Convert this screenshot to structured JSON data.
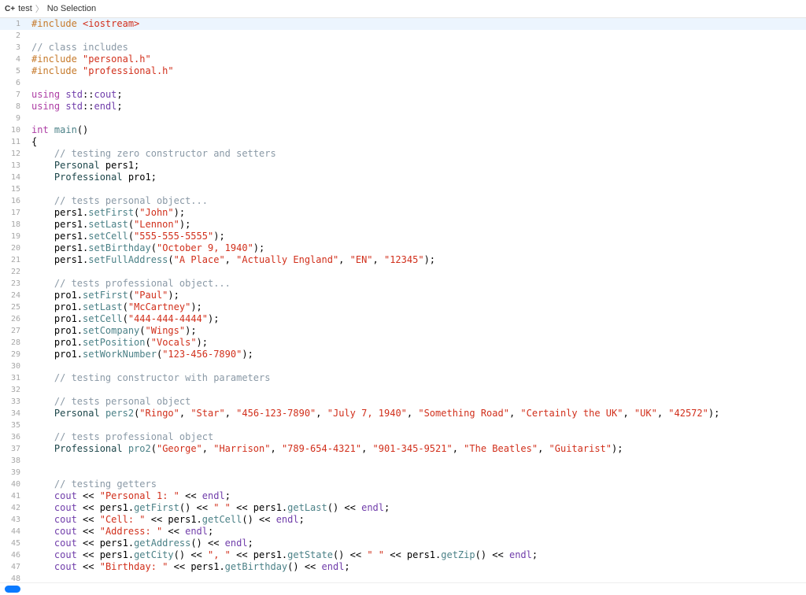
{
  "breadcrumb": {
    "lang_icon": "C+",
    "file": "test",
    "selection": "No Selection"
  },
  "highlight_line": 1,
  "lines": [
    {
      "n": 1,
      "tokens": [
        [
          "pp",
          "#include "
        ],
        [
          "inc",
          "<iostream>"
        ]
      ]
    },
    {
      "n": 2,
      "tokens": []
    },
    {
      "n": 3,
      "tokens": [
        [
          "cmt",
          "// class includes"
        ]
      ]
    },
    {
      "n": 4,
      "tokens": [
        [
          "pp",
          "#include "
        ],
        [
          "inc",
          "\"personal.h\""
        ]
      ]
    },
    {
      "n": 5,
      "tokens": [
        [
          "pp",
          "#include "
        ],
        [
          "inc",
          "\"professional.h\""
        ]
      ]
    },
    {
      "n": 6,
      "tokens": []
    },
    {
      "n": 7,
      "tokens": [
        [
          "kw",
          "using"
        ],
        [
          "txt",
          " "
        ],
        [
          "ns",
          "std"
        ],
        [
          "txt",
          "::"
        ],
        [
          "ns",
          "cout"
        ],
        [
          "txt",
          ";"
        ]
      ]
    },
    {
      "n": 8,
      "tokens": [
        [
          "kw",
          "using"
        ],
        [
          "txt",
          " "
        ],
        [
          "ns",
          "std"
        ],
        [
          "txt",
          "::"
        ],
        [
          "ns",
          "endl"
        ],
        [
          "txt",
          ";"
        ]
      ]
    },
    {
      "n": 9,
      "tokens": []
    },
    {
      "n": 10,
      "tokens": [
        [
          "kw",
          "int"
        ],
        [
          "txt",
          " "
        ],
        [
          "fn",
          "main"
        ],
        [
          "txt",
          "()"
        ]
      ]
    },
    {
      "n": 11,
      "tokens": [
        [
          "txt",
          "{"
        ]
      ]
    },
    {
      "n": 12,
      "tokens": [
        [
          "txt",
          "    "
        ],
        [
          "cmt",
          "// testing zero constructor and setters"
        ]
      ]
    },
    {
      "n": 13,
      "tokens": [
        [
          "txt",
          "    "
        ],
        [
          "type",
          "Personal"
        ],
        [
          "txt",
          " pers1;"
        ]
      ]
    },
    {
      "n": 14,
      "tokens": [
        [
          "txt",
          "    "
        ],
        [
          "type",
          "Professional"
        ],
        [
          "txt",
          " pro1;"
        ]
      ]
    },
    {
      "n": 15,
      "tokens": []
    },
    {
      "n": 16,
      "tokens": [
        [
          "txt",
          "    "
        ],
        [
          "cmt",
          "// tests personal object..."
        ]
      ]
    },
    {
      "n": 17,
      "tokens": [
        [
          "txt",
          "    pers1."
        ],
        [
          "fn",
          "setFirst"
        ],
        [
          "txt",
          "("
        ],
        [
          "inc",
          "\"John\""
        ],
        [
          "txt",
          ");"
        ]
      ]
    },
    {
      "n": 18,
      "tokens": [
        [
          "txt",
          "    pers1."
        ],
        [
          "fn",
          "setLast"
        ],
        [
          "txt",
          "("
        ],
        [
          "inc",
          "\"Lennon\""
        ],
        [
          "txt",
          ");"
        ]
      ]
    },
    {
      "n": 19,
      "tokens": [
        [
          "txt",
          "    pers1."
        ],
        [
          "fn",
          "setCell"
        ],
        [
          "txt",
          "("
        ],
        [
          "inc",
          "\"555-555-5555\""
        ],
        [
          "txt",
          ");"
        ]
      ]
    },
    {
      "n": 20,
      "tokens": [
        [
          "txt",
          "    pers1."
        ],
        [
          "fn",
          "setBirthday"
        ],
        [
          "txt",
          "("
        ],
        [
          "inc",
          "\"October 9, 1940\""
        ],
        [
          "txt",
          ");"
        ]
      ]
    },
    {
      "n": 21,
      "tokens": [
        [
          "txt",
          "    pers1."
        ],
        [
          "fn",
          "setFullAddress"
        ],
        [
          "txt",
          "("
        ],
        [
          "inc",
          "\"A Place\""
        ],
        [
          "txt",
          ", "
        ],
        [
          "inc",
          "\"Actually England\""
        ],
        [
          "txt",
          ", "
        ],
        [
          "inc",
          "\"EN\""
        ],
        [
          "txt",
          ", "
        ],
        [
          "inc",
          "\"12345\""
        ],
        [
          "txt",
          ");"
        ]
      ]
    },
    {
      "n": 22,
      "tokens": []
    },
    {
      "n": 23,
      "tokens": [
        [
          "txt",
          "    "
        ],
        [
          "cmt",
          "// tests professional object..."
        ]
      ]
    },
    {
      "n": 24,
      "tokens": [
        [
          "txt",
          "    pro1."
        ],
        [
          "fn",
          "setFirst"
        ],
        [
          "txt",
          "("
        ],
        [
          "inc",
          "\"Paul\""
        ],
        [
          "txt",
          ");"
        ]
      ]
    },
    {
      "n": 25,
      "tokens": [
        [
          "txt",
          "    pro1."
        ],
        [
          "fn",
          "setLast"
        ],
        [
          "txt",
          "("
        ],
        [
          "inc",
          "\"McCartney\""
        ],
        [
          "txt",
          ");"
        ]
      ]
    },
    {
      "n": 26,
      "tokens": [
        [
          "txt",
          "    pro1."
        ],
        [
          "fn",
          "setCell"
        ],
        [
          "txt",
          "("
        ],
        [
          "inc",
          "\"444-444-4444\""
        ],
        [
          "txt",
          ");"
        ]
      ]
    },
    {
      "n": 27,
      "tokens": [
        [
          "txt",
          "    pro1."
        ],
        [
          "fn",
          "setCompany"
        ],
        [
          "txt",
          "("
        ],
        [
          "inc",
          "\"Wings\""
        ],
        [
          "txt",
          ");"
        ]
      ]
    },
    {
      "n": 28,
      "tokens": [
        [
          "txt",
          "    pro1."
        ],
        [
          "fn",
          "setPosition"
        ],
        [
          "txt",
          "("
        ],
        [
          "inc",
          "\"Vocals\""
        ],
        [
          "txt",
          ");"
        ]
      ]
    },
    {
      "n": 29,
      "tokens": [
        [
          "txt",
          "    pro1."
        ],
        [
          "fn",
          "setWorkNumber"
        ],
        [
          "txt",
          "("
        ],
        [
          "inc",
          "\"123-456-7890\""
        ],
        [
          "txt",
          ");"
        ]
      ]
    },
    {
      "n": 30,
      "tokens": []
    },
    {
      "n": 31,
      "tokens": [
        [
          "txt",
          "    "
        ],
        [
          "cmt",
          "// testing constructor with parameters"
        ]
      ]
    },
    {
      "n": 32,
      "tokens": []
    },
    {
      "n": 33,
      "tokens": [
        [
          "txt",
          "    "
        ],
        [
          "cmt",
          "// tests personal object"
        ]
      ]
    },
    {
      "n": 34,
      "tokens": [
        [
          "txt",
          "    "
        ],
        [
          "type",
          "Personal"
        ],
        [
          "txt",
          " "
        ],
        [
          "fn",
          "pers2"
        ],
        [
          "txt",
          "("
        ],
        [
          "inc",
          "\"Ringo\""
        ],
        [
          "txt",
          ", "
        ],
        [
          "inc",
          "\"Star\""
        ],
        [
          "txt",
          ", "
        ],
        [
          "inc",
          "\"456-123-7890\""
        ],
        [
          "txt",
          ", "
        ],
        [
          "inc",
          "\"July 7, 1940\""
        ],
        [
          "txt",
          ", "
        ],
        [
          "inc",
          "\"Something Road\""
        ],
        [
          "txt",
          ", "
        ],
        [
          "inc",
          "\"Certainly the UK\""
        ],
        [
          "txt",
          ", "
        ],
        [
          "inc",
          "\"UK\""
        ],
        [
          "txt",
          ", "
        ],
        [
          "inc",
          "\"42572\""
        ],
        [
          "txt",
          ");"
        ]
      ]
    },
    {
      "n": 35,
      "tokens": []
    },
    {
      "n": 36,
      "tokens": [
        [
          "txt",
          "    "
        ],
        [
          "cmt",
          "// tests professional object"
        ]
      ]
    },
    {
      "n": 37,
      "tokens": [
        [
          "txt",
          "    "
        ],
        [
          "type",
          "Professional"
        ],
        [
          "txt",
          " "
        ],
        [
          "fn",
          "pro2"
        ],
        [
          "txt",
          "("
        ],
        [
          "inc",
          "\"George\""
        ],
        [
          "txt",
          ", "
        ],
        [
          "inc",
          "\"Harrison\""
        ],
        [
          "txt",
          ", "
        ],
        [
          "inc",
          "\"789-654-4321\""
        ],
        [
          "txt",
          ", "
        ],
        [
          "inc",
          "\"901-345-9521\""
        ],
        [
          "txt",
          ", "
        ],
        [
          "inc",
          "\"The Beatles\""
        ],
        [
          "txt",
          ", "
        ],
        [
          "inc",
          "\"Guitarist\""
        ],
        [
          "txt",
          ");"
        ]
      ]
    },
    {
      "n": 38,
      "tokens": []
    },
    {
      "n": 39,
      "tokens": []
    },
    {
      "n": 40,
      "tokens": [
        [
          "txt",
          "    "
        ],
        [
          "cmt",
          "// testing getters"
        ]
      ]
    },
    {
      "n": 41,
      "tokens": [
        [
          "txt",
          "    "
        ],
        [
          "ns",
          "cout"
        ],
        [
          "txt",
          " << "
        ],
        [
          "inc",
          "\"Personal 1: \""
        ],
        [
          "txt",
          " << "
        ],
        [
          "ns",
          "endl"
        ],
        [
          "txt",
          ";"
        ]
      ]
    },
    {
      "n": 42,
      "tokens": [
        [
          "txt",
          "    "
        ],
        [
          "ns",
          "cout"
        ],
        [
          "txt",
          " << pers1."
        ],
        [
          "fn",
          "getFirst"
        ],
        [
          "txt",
          "() << "
        ],
        [
          "inc",
          "\" \""
        ],
        [
          "txt",
          " << pers1."
        ],
        [
          "fn",
          "getLast"
        ],
        [
          "txt",
          "() << "
        ],
        [
          "ns",
          "endl"
        ],
        [
          "txt",
          ";"
        ]
      ]
    },
    {
      "n": 43,
      "tokens": [
        [
          "txt",
          "    "
        ],
        [
          "ns",
          "cout"
        ],
        [
          "txt",
          " << "
        ],
        [
          "inc",
          "\"Cell: \""
        ],
        [
          "txt",
          " << pers1."
        ],
        [
          "fn",
          "getCell"
        ],
        [
          "txt",
          "() << "
        ],
        [
          "ns",
          "endl"
        ],
        [
          "txt",
          ";"
        ]
      ]
    },
    {
      "n": 44,
      "tokens": [
        [
          "txt",
          "    "
        ],
        [
          "ns",
          "cout"
        ],
        [
          "txt",
          " << "
        ],
        [
          "inc",
          "\"Address: \""
        ],
        [
          "txt",
          " << "
        ],
        [
          "ns",
          "endl"
        ],
        [
          "txt",
          ";"
        ]
      ]
    },
    {
      "n": 45,
      "tokens": [
        [
          "txt",
          "    "
        ],
        [
          "ns",
          "cout"
        ],
        [
          "txt",
          " << pers1."
        ],
        [
          "fn",
          "getAddress"
        ],
        [
          "txt",
          "() << "
        ],
        [
          "ns",
          "endl"
        ],
        [
          "txt",
          ";"
        ]
      ]
    },
    {
      "n": 46,
      "tokens": [
        [
          "txt",
          "    "
        ],
        [
          "ns",
          "cout"
        ],
        [
          "txt",
          " << pers1."
        ],
        [
          "fn",
          "getCity"
        ],
        [
          "txt",
          "() << "
        ],
        [
          "inc",
          "\", \""
        ],
        [
          "txt",
          " << pers1."
        ],
        [
          "fn",
          "getState"
        ],
        [
          "txt",
          "() << "
        ],
        [
          "inc",
          "\" \""
        ],
        [
          "txt",
          " << pers1."
        ],
        [
          "fn",
          "getZip"
        ],
        [
          "txt",
          "() << "
        ],
        [
          "ns",
          "endl"
        ],
        [
          "txt",
          ";"
        ]
      ]
    },
    {
      "n": 47,
      "tokens": [
        [
          "txt",
          "    "
        ],
        [
          "ns",
          "cout"
        ],
        [
          "txt",
          " << "
        ],
        [
          "inc",
          "\"Birthday: \""
        ],
        [
          "txt",
          " << pers1."
        ],
        [
          "fn",
          "getBirthday"
        ],
        [
          "txt",
          "() << "
        ],
        [
          "ns",
          "endl"
        ],
        [
          "txt",
          ";"
        ]
      ]
    },
    {
      "n": 48,
      "tokens": []
    }
  ]
}
